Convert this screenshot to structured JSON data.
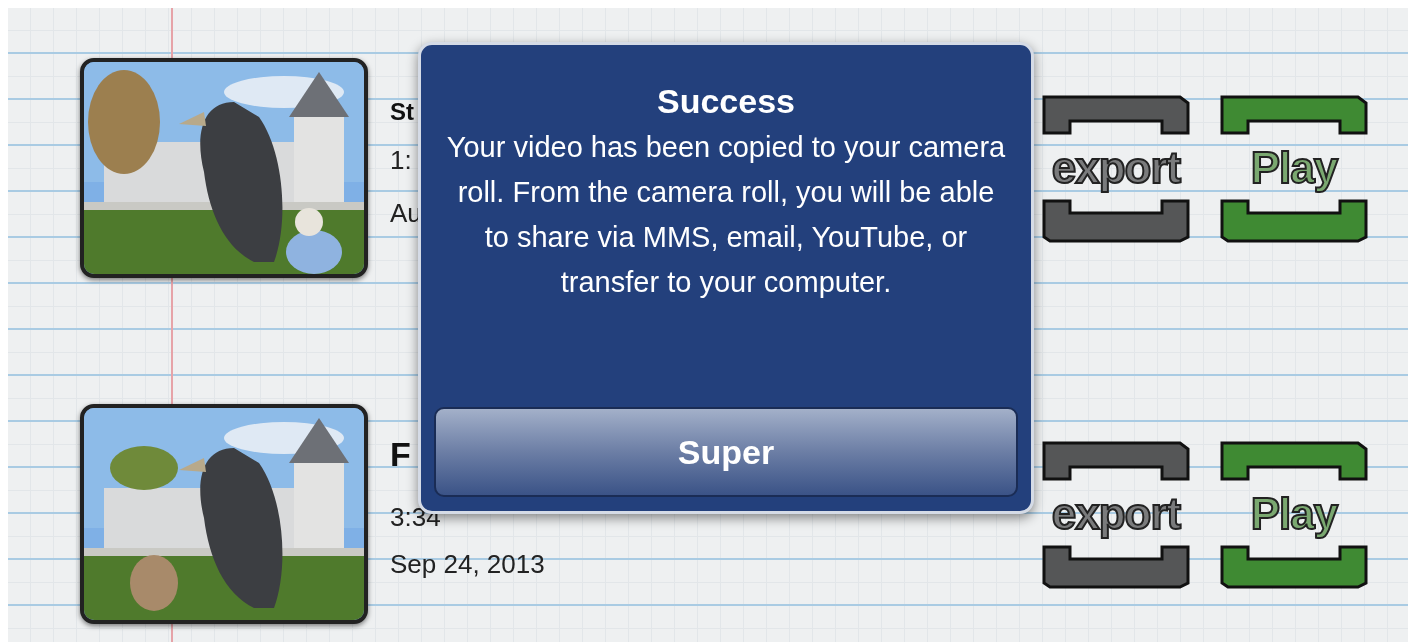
{
  "videos": [
    {
      "title": "St",
      "duration": "1:",
      "date": "Au",
      "export_label": "export",
      "play_label": "Play"
    },
    {
      "title": "F",
      "duration": "3:34",
      "date": "Sep 24, 2013",
      "export_label": "export",
      "play_label": "Play"
    }
  ],
  "alert": {
    "title": "Success",
    "message": "Your video has been copied to your camera roll. From the camera roll, you will be able to share via MMS, email, YouTube, or transfer to your computer.",
    "button": "Super"
  }
}
